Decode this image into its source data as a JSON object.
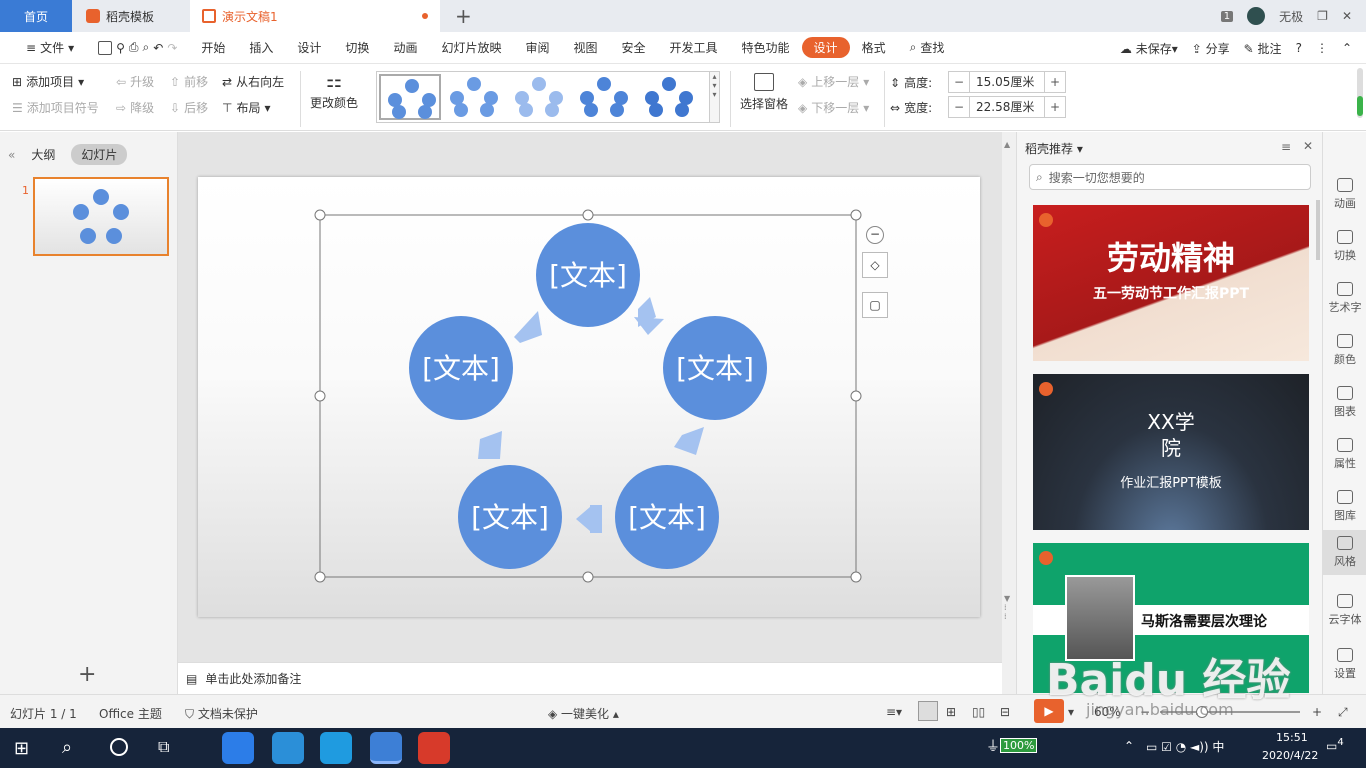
{
  "titlebar": {
    "home": "首页",
    "tab_template": "稻壳模板",
    "tab_doc": "演示文稿1",
    "user": "无极",
    "badge": "1"
  },
  "menu": {
    "file": "文件",
    "items": [
      "开始",
      "插入",
      "设计",
      "切换",
      "动画",
      "幻灯片放映",
      "审阅",
      "视图",
      "安全",
      "开发工具",
      "特色功能"
    ],
    "active": "设计",
    "format": "格式",
    "search": "查找",
    "unsaved": "未保存",
    "share": "分享",
    "comment": "批注"
  },
  "ribbon": {
    "add_item": "添加项目",
    "add_bullet": "添加项目符号",
    "upgrade": "升级",
    "downgrade": "降级",
    "forward": "前移",
    "backward": "后移",
    "rtl": "从右向左",
    "layout": "布局",
    "change_color": "更改颜色",
    "select_pane": "选择窗格",
    "up_layer": "上移一层",
    "down_layer": "下移一层",
    "height_label": "高度:",
    "height_value": "15.05厘米",
    "width_label": "宽度:",
    "width_value": "22.58厘米"
  },
  "leftpanel": {
    "outline": "大纲",
    "slides": "幻灯片",
    "slide_num": "1"
  },
  "slide": {
    "nodes": [
      "[文本]",
      "[文本]",
      "[文本]",
      "[文本]",
      "[文本]"
    ]
  },
  "notes": "单击此处添加备注",
  "rightpanel": {
    "title": "稻壳推荐",
    "search_placeholder": "搜索一切您想要的",
    "card1_title": "劳动精神",
    "card1_sub": "五一劳动节工作汇报PPT",
    "card2_title1": "XX学",
    "card2_title2": "院",
    "card2_sub": "作业汇报PPT模板",
    "card3_title": "马斯洛需要层次理论"
  },
  "righttools": [
    "动画",
    "切换",
    "艺术字",
    "颜色",
    "图表",
    "属性",
    "图库",
    "风格",
    "云字体",
    "设置"
  ],
  "status": {
    "slide": "幻灯片 1 / 1",
    "theme": "Office 主题",
    "protect": "文档未保护",
    "beautify": "一键美化",
    "zoom": "60%"
  },
  "taskbar": {
    "battery": "100%",
    "time": "15:51",
    "date": "2020/4/22",
    "notif": "4"
  },
  "watermark": "Baidu 经验",
  "watermark_url": "jingyan.baidu.com",
  "colors": {
    "accent": "#e8622d",
    "node": "#5b8fdc",
    "arrow": "#a4c2f0"
  }
}
